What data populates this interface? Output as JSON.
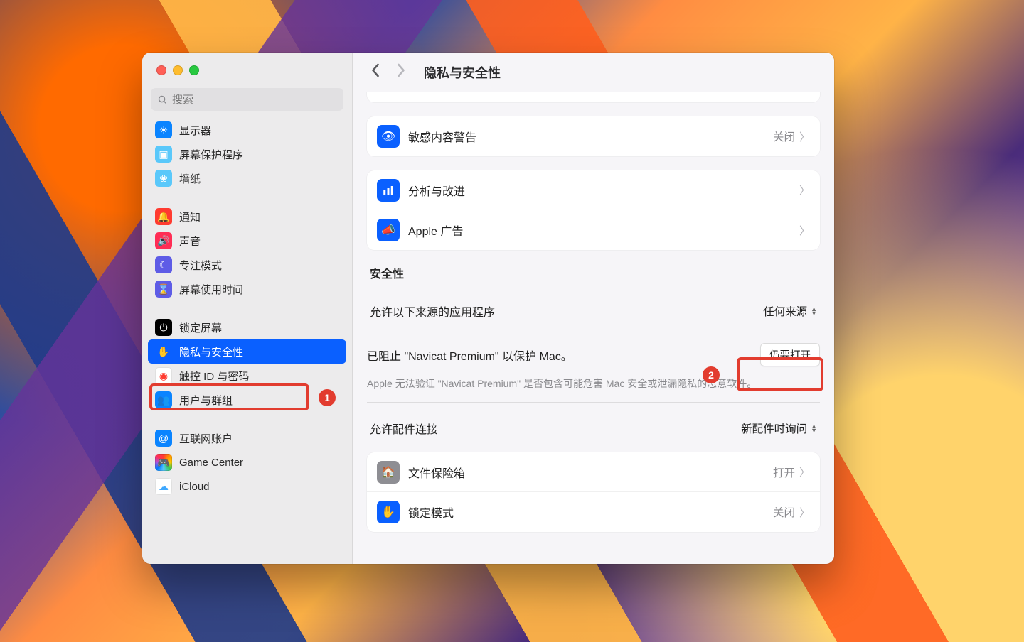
{
  "header": {
    "title": "隐私与安全性",
    "search_placeholder": "搜索"
  },
  "sidebar": {
    "items": [
      {
        "label": "显示器",
        "icon_bg": "#0a84ff",
        "glyph": "☀"
      },
      {
        "label": "屏幕保护程序",
        "icon_bg": "#5ac8fa",
        "glyph": "▣"
      },
      {
        "label": "墙纸",
        "icon_bg": "#5ac8fa",
        "glyph": "❀"
      },
      {
        "label": "通知",
        "icon_bg": "#ff3b30",
        "glyph": "🔔"
      },
      {
        "label": "声音",
        "icon_bg": "#ff2d55",
        "glyph": "🔊"
      },
      {
        "label": "专注模式",
        "icon_bg": "#5e5ce6",
        "glyph": "☾"
      },
      {
        "label": "屏幕使用时间",
        "icon_bg": "#5e5ce6",
        "glyph": "⌛"
      },
      {
        "label": "锁定屏幕",
        "icon_bg": "#000000",
        "glyph": "⏻"
      },
      {
        "label": "隐私与安全性",
        "icon_bg": "#0a60ff",
        "glyph": "✋"
      },
      {
        "label": "触控 ID 与密码",
        "icon_bg": "#ffffff",
        "glyph": "◉",
        "glyph_color": "#ff3b30"
      },
      {
        "label": "用户与群组",
        "icon_bg": "#0a84ff",
        "glyph": "👥"
      },
      {
        "label": "互联网账户",
        "icon_bg": "#0a84ff",
        "glyph": "@"
      },
      {
        "label": "Game Center",
        "icon_bg": "#ffffff",
        "glyph": "🎮",
        "rainbow": true
      },
      {
        "label": "iCloud",
        "icon_bg": "#ffffff",
        "glyph": "☁",
        "glyph_color": "#3ea8ff"
      }
    ],
    "gap_after": [
      2,
      6,
      10
    ]
  },
  "rows": {
    "sensitive": {
      "label": "敏感内容警告",
      "value": "关闭",
      "icon_bg": "#0a60ff",
      "glyph": "👁"
    },
    "analytics": {
      "label": "分析与改进",
      "icon_bg": "#0a60ff",
      "glyph": "📊"
    },
    "apple_ads": {
      "label": "Apple 广告",
      "icon_bg": "#0a60ff",
      "glyph": "📣"
    },
    "filevault": {
      "label": "文件保险箱",
      "value": "打开",
      "icon_bg": "#8e8e93",
      "glyph": "🏠"
    },
    "lockdown": {
      "label": "锁定模式",
      "value": "关闭",
      "icon_bg": "#0a60ff",
      "glyph": "✋"
    }
  },
  "security": {
    "header": "安全性",
    "allow_apps_label": "允许以下来源的应用程序",
    "allow_apps_value": "任何来源",
    "blocked_label": "已阻止 \"Navicat Premium\" 以保护 Mac。",
    "open_anyway": "仍要打开",
    "hint": "Apple 无法验证 \"Navicat Premium\" 是否包含可能危害 Mac 安全或泄漏隐私的恶意软件。",
    "accessories_label": "允许配件连接",
    "accessories_value": "新配件时询问"
  },
  "annotations": {
    "one": "1",
    "two": "2"
  }
}
